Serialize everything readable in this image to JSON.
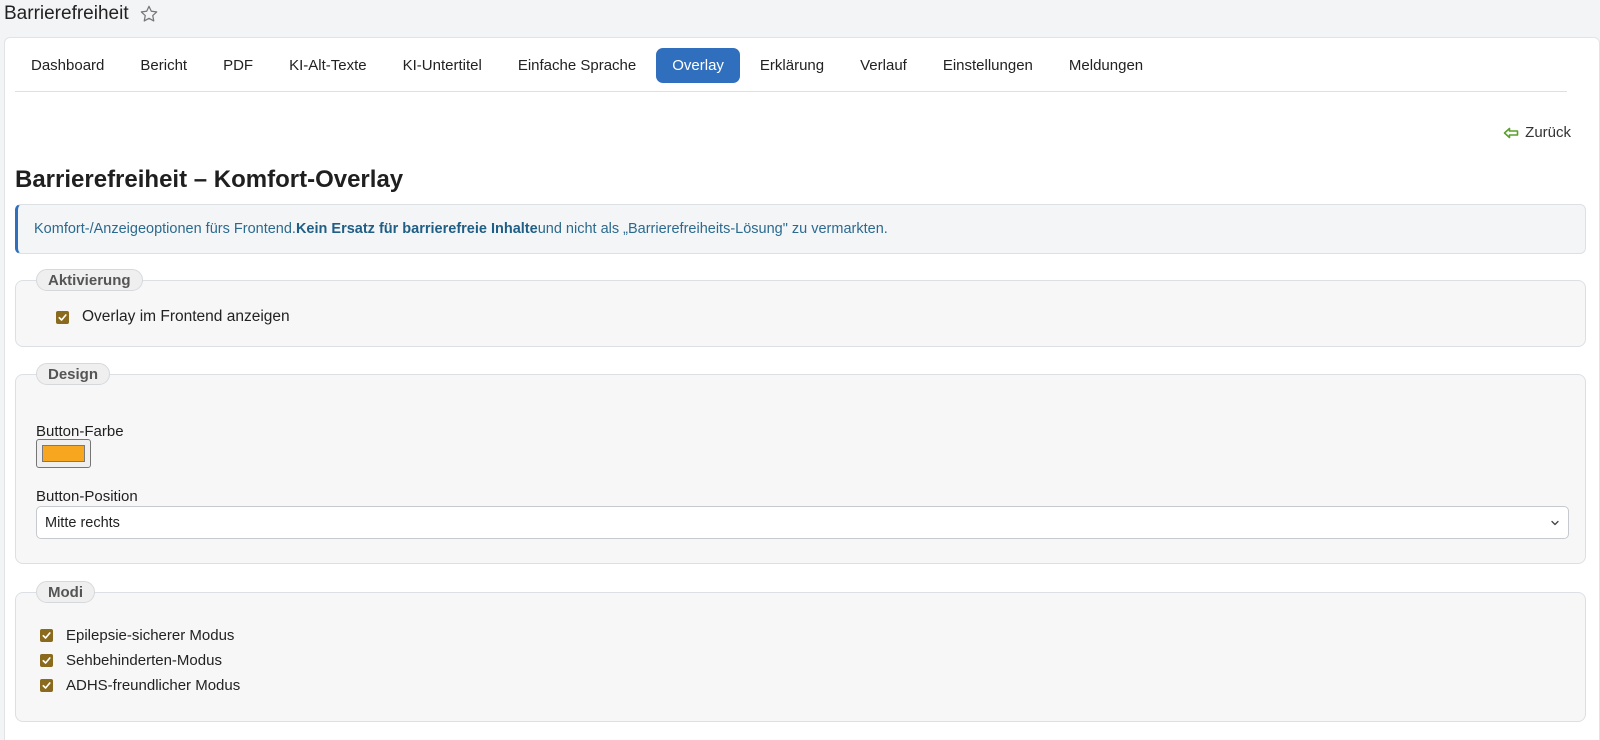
{
  "page": {
    "title": "Barrierefreiheit",
    "star_icon": "star-outline-icon"
  },
  "tabs": [
    {
      "label": "Dashboard",
      "active": false
    },
    {
      "label": "Bericht",
      "active": false
    },
    {
      "label": "PDF",
      "active": false
    },
    {
      "label": "KI-Alt-Texte",
      "active": false
    },
    {
      "label": "KI-Untertitel",
      "active": false
    },
    {
      "label": "Einfache Sprache",
      "active": false
    },
    {
      "label": "Overlay",
      "active": true
    },
    {
      "label": "Erklärung",
      "active": false
    },
    {
      "label": "Verlauf",
      "active": false
    },
    {
      "label": "Einstellungen",
      "active": false
    },
    {
      "label": "Meldungen",
      "active": false
    }
  ],
  "back": {
    "label": "Zurück",
    "icon": "arrow-left-icon"
  },
  "heading": "Barrierefreiheit – Komfort-Overlay",
  "info": {
    "text_before": "Komfort-/Anzeigeoptionen fürs Frontend. ",
    "text_bold": "Kein Ersatz für barrierefreie Inhalte",
    "text_after": " und nicht als „Barrierefreiheits-Lösung\" zu vermarkten."
  },
  "activation": {
    "legend": "Aktivierung",
    "checkbox_label": "Overlay im Frontend anzeigen",
    "checked": true
  },
  "design": {
    "legend": "Design",
    "color_label": "Button-Farbe",
    "color_value": "#f7a61f",
    "position_label": "Button-Position",
    "position_value": "Mitte rechts"
  },
  "modes": {
    "legend": "Modi",
    "items": [
      {
        "label": "Epilepsie-sicherer Modus",
        "checked": true
      },
      {
        "label": "Sehbehinderten-Modus",
        "checked": true
      },
      {
        "label": "ADHS-freundlicher Modus",
        "checked": true
      }
    ]
  },
  "colors": {
    "accent": "#2f6fbe",
    "checkbox": "#8a6a1d",
    "info_text": "#2b6a8f",
    "back_icon": "#5aa02c"
  }
}
